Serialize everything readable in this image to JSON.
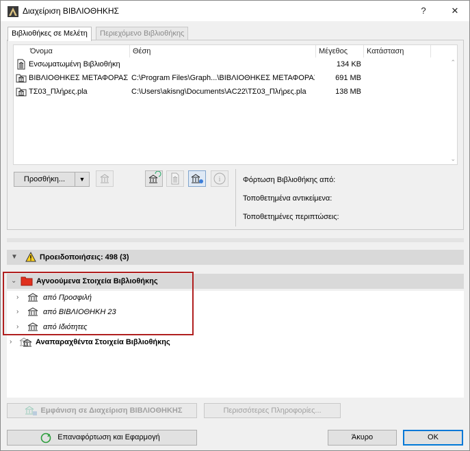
{
  "window": {
    "title": "Διαχείριση ΒΙΒΛΙΟΘΗΚΗΣ",
    "help_label": "?",
    "close_label": "✕"
  },
  "tabs": [
    {
      "label": "Βιβλιοθήκες σε Μελέτη"
    },
    {
      "label": "Περιεχόμενο Βιβλιοθήκης"
    }
  ],
  "table": {
    "headers": {
      "name": "Όνομα",
      "location": "Θέση",
      "size": "Μέγεθος",
      "status": "Κατάσταση"
    },
    "rows": [
      {
        "name": "Ενσωματωμένη Βιβλιοθήκη",
        "location": "",
        "size": "134 KB"
      },
      {
        "name": "ΒΙΒΛΙΟΘΗΚΕΣ ΜΕΤΑΦΟΡΑΣ",
        "location": "C:\\Program Files\\Graph...\\ΒΙΒΛΙΟΘΗΚΕΣ ΜΕΤΑΦΟΡΑΣ",
        "size": "691 MB"
      },
      {
        "name": "ΤΣ03_Πλήρες.pla",
        "location": "C:\\Users\\akisng\\Documents\\AC22\\ΤΣ03_Πλήρες.pla",
        "size": "138 MB"
      }
    ]
  },
  "actions": {
    "add_label": "Προσθήκη..."
  },
  "details": {
    "loaded_from": "Φόρτωση Βιβλιοθήκης από:",
    "placed_objects": "Τοποθετημένα αντικείμενα:",
    "placed_instances": "Τοποθετημένες περιπτώσεις:"
  },
  "warnings": {
    "label": "Προειδοποιήσεις: 498 (3)"
  },
  "missing": {
    "label": "Αγνοούμενα Στοιχεία Βιβλιοθήκης",
    "items": [
      {
        "label": "από Προσφιλή"
      },
      {
        "label": "από ΒΙΒΛΙΟΘΗΚΗ 23"
      },
      {
        "label": "από Ιδιότητες"
      }
    ]
  },
  "duplicate": {
    "label": "Αναπαραχθέντα Στοιχεία Βιβλιοθήκης"
  },
  "bottom": {
    "show_in_manager": "Εμφάνιση σε Διαχείριση ΒΙΒΛΙΟΘΗΚΗΣ",
    "more_info": "Περισσότερες Πληροφορίες...",
    "reload_apply": "Επαναφόρτωση και Εφαρμογή",
    "cancel": "Άκυρο",
    "ok": "OK"
  },
  "colors": {
    "accent": "#0078d7",
    "folder": "#e0301e",
    "highlight_border": "#b01e1e"
  }
}
